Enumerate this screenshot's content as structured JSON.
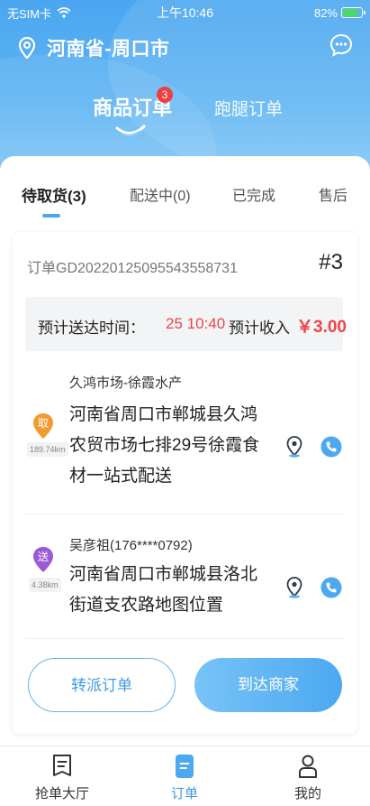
{
  "status_bar": {
    "carrier": "无SIM卡",
    "time": "上午10:46",
    "battery": "82%",
    "battery_level": 0.82
  },
  "header": {
    "location": "河南省-周口市"
  },
  "top_tabs": [
    {
      "label": "商品订单",
      "badge": "3",
      "active": true
    },
    {
      "label": "跑腿订单",
      "active": false
    }
  ],
  "status_tabs": [
    {
      "label": "待取货(3)",
      "active": true
    },
    {
      "label": "配送中(0)",
      "active": false
    },
    {
      "label": "已完成",
      "active": false
    },
    {
      "label": "售后",
      "active": false
    }
  ],
  "order": {
    "number": "订单GD2022012509554355873‍1",
    "seq": "#3",
    "eta_label": "预计送达时间：",
    "eta_value": "25 10:40",
    "income_label": "预计收入",
    "income_value": "￥3.00",
    "pickup": {
      "tag": "取",
      "distance": "189.74km",
      "name": "久鸿市场-徐霞水产",
      "address": "河南省周口市郸城县久鸿农贸市场七排29号徐霞食材一站式配送"
    },
    "delivery": {
      "tag": "送",
      "distance": "4.38km",
      "name": "吴彦祖(176****0792)",
      "address": "河南省周口市郸城县洛北街道支农路地图位置"
    },
    "reassign_label": "转派订单",
    "arrive_label": "到达商家"
  },
  "bottom_nav": [
    {
      "label": "抢单大厅",
      "icon": "clipboard-icon",
      "active": false
    },
    {
      "label": "订单",
      "icon": "order-icon",
      "active": true
    },
    {
      "label": "我的",
      "icon": "person-icon",
      "active": false
    }
  ],
  "colors": {
    "accent": "#4aa6f0",
    "price": "#f04545",
    "pickup_pin": "#f29b2e",
    "delivery_pin": "#9b59d9"
  }
}
